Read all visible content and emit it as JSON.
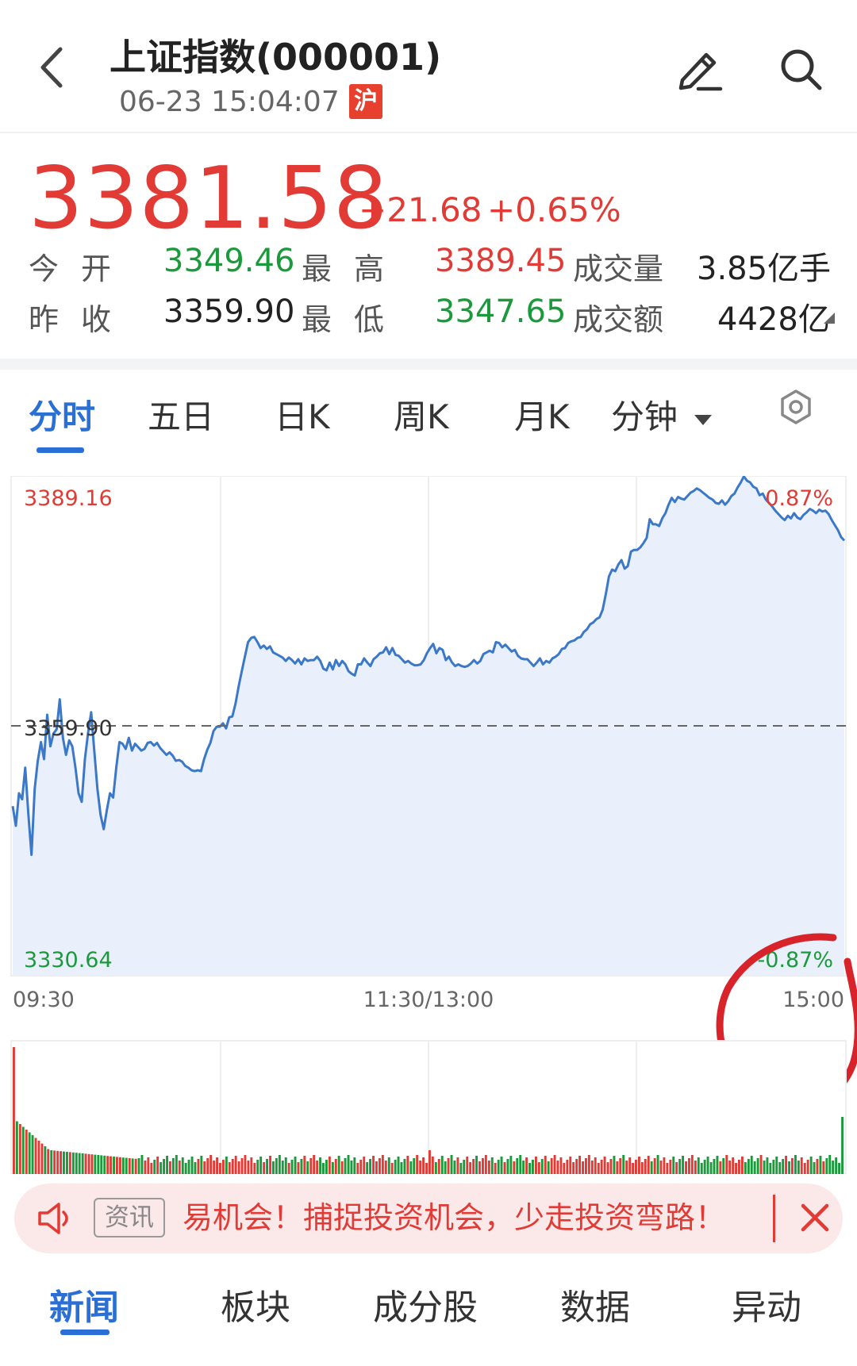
{
  "header": {
    "title": "上证指数(000001)",
    "datetime": "06-23 15:04:07",
    "market_badge": "沪"
  },
  "quote": {
    "price": "3381.58",
    "change": "+21.68",
    "change_pct": "+0.65%",
    "open_label": "今开",
    "open_value": "3349.46",
    "prev_close_label": "昨收",
    "prev_close_value": "3359.90",
    "high_label": "最高",
    "high_value": "3389.45",
    "low_label": "最低",
    "low_value": "3347.65",
    "volume_label": "成交量",
    "volume_value": "3.85亿手",
    "turnover_label": "成交额",
    "turnover_value": "4428亿"
  },
  "chart_tabs": {
    "items": [
      "分时",
      "五日",
      "日K",
      "周K",
      "月K",
      "分钟"
    ],
    "active": "分时"
  },
  "chart_data": {
    "type": "line",
    "y_top_label": "3389.16",
    "y_mid_label": "3359.90",
    "y_bottom_label": "3330.64",
    "pct_top_label": "0.87%",
    "pct_bottom_label": "-0.87%",
    "x_labels": [
      "09:30",
      "11:30/13:00",
      "15:00"
    ],
    "ylim": [
      3330.64,
      3389.16
    ],
    "prev_close": 3359.9,
    "series": [
      {
        "values": [
          3350.5,
          3348.2,
          3352.0,
          3351.3,
          3355.0,
          3349.5,
          3344.8,
          3352.5,
          3355.8,
          3358.0,
          3356.0,
          3361.2,
          3357.5,
          3359.0,
          3359.5,
          3363.0,
          3358.5,
          3356.5,
          3358.2,
          3357.5,
          3355.0,
          3352.0,
          3351.0,
          3356.0,
          3359.0,
          3361.5,
          3357.0,
          3352.5,
          3349.5,
          3347.8,
          3350.0,
          3352.0,
          3351.5,
          3355.0,
          3358.0,
          3357.8,
          3357.2,
          3358.5,
          3357.0,
          3357.8,
          3357.4,
          3357.0,
          3357.2,
          3357.9,
          3358.0,
          3357.6,
          3357.9,
          3357.3,
          3356.9,
          3356.5,
          3356.8,
          3356.4,
          3355.8,
          3355.9,
          3355.7,
          3355.2,
          3355.0,
          3354.7,
          3354.6,
          3354.7,
          3354.6,
          3356.0,
          3357.1,
          3357.9,
          3359.3,
          3359.8,
          3359.8,
          3360.2,
          3359.6,
          3360.9,
          3361.0,
          3362.5,
          3364.5,
          3366.3,
          3368.0,
          3369.7,
          3370.2,
          3370.3,
          3369.7,
          3369.0,
          3369.3,
          3368.9,
          3369.2,
          3368.5,
          3368.3,
          3368.1,
          3367.9,
          3367.5,
          3367.9,
          3367.6,
          3367.2,
          3367.7,
          3367.1,
          3367.8,
          3367.5,
          3367.6,
          3367.6,
          3368.0,
          3367.5,
          3366.6,
          3366.4,
          3367.3,
          3366.5,
          3367.6,
          3366.9,
          3367.5,
          3367.1,
          3366.3,
          3366.0,
          3365.8,
          3367.1,
          3367.1,
          3367.8,
          3367.3,
          3366.9,
          3367.7,
          3368.0,
          3368.4,
          3368.5,
          3369.1,
          3368.3,
          3369.0,
          3368.2,
          3368.1,
          3367.7,
          3367.3,
          3367.5,
          3367.2,
          3367.0,
          3367.0,
          3367.1,
          3367.6,
          3368.4,
          3369.0,
          3369.5,
          3368.4,
          3369.0,
          3368.8,
          3367.6,
          3368.0,
          3367.3,
          3366.9,
          3367.1,
          3366.9,
          3366.8,
          3366.9,
          3367.2,
          3367.6,
          3367.2,
          3367.5,
          3368.3,
          3368.5,
          3368.7,
          3368.5,
          3369.7,
          3369.6,
          3369.1,
          3369.4,
          3369.0,
          3368.6,
          3368.8,
          3368.1,
          3367.8,
          3367.7,
          3367.7,
          3367.3,
          3366.9,
          3367.3,
          3367.8,
          3367.1,
          3367.5,
          3367.3,
          3367.8,
          3368.0,
          3368.3,
          3368.9,
          3369.0,
          3369.6,
          3369.8,
          3369.9,
          3370.2,
          3370.3,
          3370.9,
          3371.2,
          3371.8,
          3372.0,
          3372.4,
          3372.6,
          3373.5,
          3375.3,
          3377.4,
          3378.2,
          3378.0,
          3378.8,
          3379.3,
          3378.3,
          3378.6,
          3380.3,
          3380.5,
          3380.5,
          3380.8,
          3381.3,
          3381.9,
          3384.1,
          3383.5,
          3383.5,
          3383.3,
          3384.2,
          3384.8,
          3385.8,
          3386.6,
          3386.1,
          3386.7,
          3386.5,
          3386.4,
          3386.8,
          3387.2,
          3387.4,
          3387.7,
          3387.5,
          3387.2,
          3386.9,
          3386.6,
          3386.4,
          3386.0,
          3385.9,
          3386.3,
          3385.8,
          3386.2,
          3386.8,
          3387.1,
          3387.8,
          3388.4,
          3389.1,
          3388.6,
          3388.4,
          3387.9,
          3387.7,
          3386.9,
          3387.1,
          3386.4,
          3386.0,
          3385.6,
          3385.1,
          3384.7,
          3384.3,
          3384.0,
          3384.5,
          3384.2,
          3384.8,
          3384.3,
          3384.1,
          3384.6,
          3384.9,
          3385.3,
          3385.1,
          3384.8,
          3385.2,
          3385.0,
          3385.1,
          3384.7,
          3384.0,
          3383.4,
          3382.8,
          3382.0,
          3381.6
        ]
      }
    ]
  },
  "ticker": {
    "tag": "资讯",
    "text": "易机会！捕捉投资机会，少走投资弯路！"
  },
  "bottom_nav": {
    "items": [
      "新闻",
      "板块",
      "成分股",
      "数据",
      "异动"
    ],
    "active": "新闻"
  },
  "colors": {
    "up": "#e23a35",
    "down": "#1a9a3a",
    "accent": "#2a6fd6",
    "line": "#3b78c9",
    "area": "#e9f0fb",
    "annotation": "#d8232a"
  },
  "icons": {
    "back": "chevron-left-icon",
    "edit": "pencil-icon",
    "search": "search-icon",
    "settings": "settings-icon",
    "speaker": "speaker-icon",
    "close": "close-icon"
  }
}
